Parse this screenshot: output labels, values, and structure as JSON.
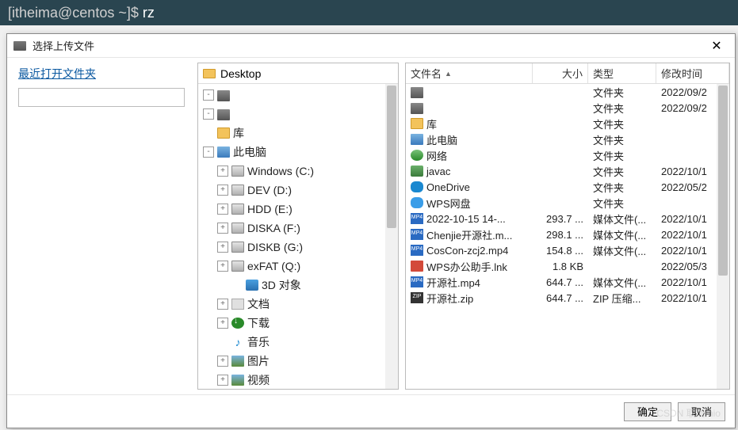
{
  "terminal": {
    "prompt": "[itheima@centos ~]$ ",
    "cmd": "rz"
  },
  "dialog": {
    "title": "选择上传文件",
    "recent_label": "最近打开文件夹",
    "path_current": "Desktop",
    "ok": "确定",
    "cancel": "取消"
  },
  "tree": [
    {
      "level": 1,
      "exp": "-",
      "icon": "disk",
      "label": ""
    },
    {
      "level": 1,
      "exp": "-",
      "icon": "disk",
      "label": ""
    },
    {
      "level": 1,
      "exp": "",
      "icon": "folder",
      "label": "库"
    },
    {
      "level": 1,
      "exp": "-",
      "icon": "pc",
      "label": "此电脑"
    },
    {
      "level": 2,
      "exp": "+",
      "icon": "drive",
      "label": "Windows (C:)"
    },
    {
      "level": 2,
      "exp": "+",
      "icon": "drive",
      "label": "DEV (D:)"
    },
    {
      "level": 2,
      "exp": "+",
      "icon": "drive",
      "label": "HDD (E:)"
    },
    {
      "level": 2,
      "exp": "+",
      "icon": "drive",
      "label": "DISKA (F:)"
    },
    {
      "level": 2,
      "exp": "+",
      "icon": "drive",
      "label": "DISKB (G:)"
    },
    {
      "level": 2,
      "exp": "+",
      "icon": "drive",
      "label": "exFAT (Q:)"
    },
    {
      "level": 3,
      "exp": "",
      "icon": "3d",
      "label": "3D 对象"
    },
    {
      "level": 2,
      "exp": "+",
      "icon": "doc",
      "label": "文档"
    },
    {
      "level": 2,
      "exp": "+",
      "icon": "dl",
      "label": "下载"
    },
    {
      "level": 2,
      "exp": "",
      "icon": "music",
      "label": "音乐"
    },
    {
      "level": 2,
      "exp": "+",
      "icon": "img",
      "label": "图片"
    },
    {
      "level": 2,
      "exp": "+",
      "icon": "img",
      "label": "视频"
    }
  ],
  "columns": {
    "name": "文件名",
    "size": "大小",
    "type": "类型",
    "date": "修改时间"
  },
  "files": [
    {
      "icon": "disk",
      "name": "",
      "size": "",
      "type": "文件夹",
      "date": "2022/09/2"
    },
    {
      "icon": "disk",
      "name": "",
      "size": "",
      "type": "文件夹",
      "date": "2022/09/2"
    },
    {
      "icon": "folder",
      "name": "库",
      "size": "",
      "type": "文件夹",
      "date": ""
    },
    {
      "icon": "pc",
      "name": "此电脑",
      "size": "",
      "type": "文件夹",
      "date": ""
    },
    {
      "icon": "net",
      "name": "网络",
      "size": "",
      "type": "文件夹",
      "date": ""
    },
    {
      "icon": "user",
      "name": "javac",
      "size": "",
      "type": "文件夹",
      "date": "2022/10/1"
    },
    {
      "icon": "cloud",
      "name": "OneDrive",
      "size": "",
      "type": "文件夹",
      "date": "2022/05/2"
    },
    {
      "icon": "cloud2",
      "name": "WPS网盘",
      "size": "",
      "type": "文件夹",
      "date": ""
    },
    {
      "icon": "mp4",
      "name": "2022-10-15 14-...",
      "size": "293.7 ...",
      "type": "媒体文件(...",
      "date": "2022/10/1"
    },
    {
      "icon": "mp4",
      "name": "Chenjie开源社.m...",
      "size": "298.1 ...",
      "type": "媒体文件(...",
      "date": "2022/10/1"
    },
    {
      "icon": "mp4",
      "name": "CosCon-zcj2.mp4",
      "size": "154.8 ...",
      "type": "媒体文件(...",
      "date": "2022/10/1"
    },
    {
      "icon": "lnk",
      "name": "WPS办公助手.lnk",
      "size": "1.8 KB",
      "type": "",
      "date": "2022/05/3"
    },
    {
      "icon": "mp4",
      "name": "开源社.mp4",
      "size": "644.7 ...",
      "type": "媒体文件(...",
      "date": "2022/10/1"
    },
    {
      "icon": "zip",
      "name": "开源社.zip",
      "size": "644.7 ...",
      "type": "ZIP 压缩...",
      "date": "2022/10/1"
    }
  ],
  "watermark": "CSDN 取消mio"
}
